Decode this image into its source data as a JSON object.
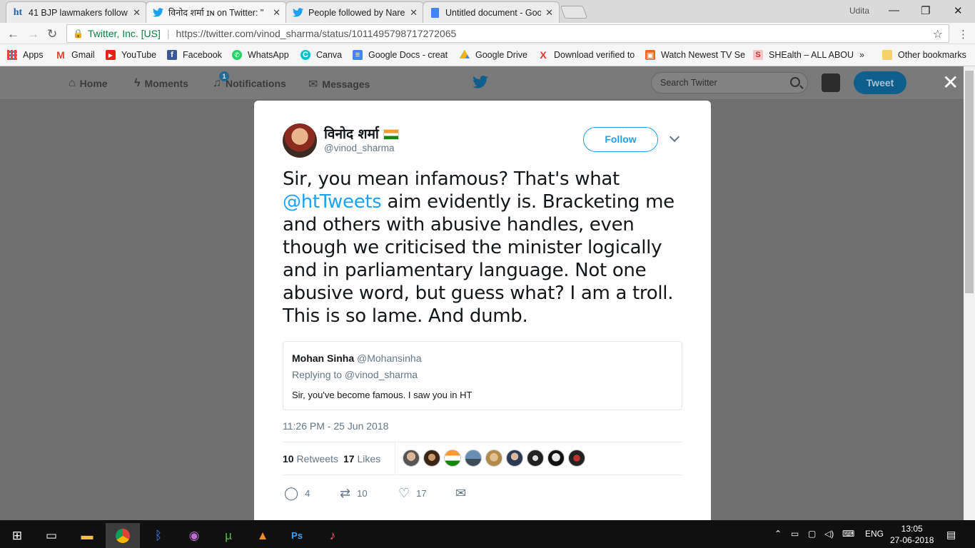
{
  "browser": {
    "tabs": [
      {
        "title": "41 BJP lawmakers follow",
        "icon": "ht-logo-icon"
      },
      {
        "title": "विनोद शर्मा ɪɴ on Twitter: \"",
        "icon": "twitter-bird-icon"
      },
      {
        "title": "People followed by Naren",
        "icon": "twitter-bird-icon"
      },
      {
        "title": "Untitled document - Goo",
        "icon": "google-docs-icon"
      }
    ],
    "user": "Udita",
    "secure_label": "Twitter, Inc. [US]",
    "url": "https://twitter.com/vinod_sharma/status/1011495798717272065",
    "bookmarks": [
      {
        "label": "Apps",
        "icon": "apps-grid-icon"
      },
      {
        "label": "Gmail",
        "icon": "gmail-icon"
      },
      {
        "label": "YouTube",
        "icon": "youtube-icon"
      },
      {
        "label": "Facebook",
        "icon": "facebook-icon"
      },
      {
        "label": "WhatsApp",
        "icon": "whatsapp-icon"
      },
      {
        "label": "Canva",
        "icon": "canva-icon"
      },
      {
        "label": "Google Docs - creat",
        "icon": "google-docs-icon"
      },
      {
        "label": "Google Drive",
        "icon": "google-drive-icon"
      },
      {
        "label": "Download verified to",
        "icon": "x-icon"
      },
      {
        "label": "Watch Newest TV Se",
        "icon": "movie-icon"
      },
      {
        "label": "SHEalth – ALL ABOU",
        "icon": "shealth-icon"
      }
    ],
    "bookmarks_more": "»",
    "other_bookmarks": "Other bookmarks"
  },
  "twitter_nav": {
    "home": "Home",
    "moments": "Moments",
    "notifications": "Notifications",
    "notification_count": "1",
    "messages": "Messages",
    "search_placeholder": "Search Twitter",
    "tweet_button": "Tweet"
  },
  "tweet": {
    "author_name": "विनोद शर्मा",
    "author_handle": "@vinod_sharma",
    "follow_label": "Follow",
    "text_before": "Sir, you mean infamous? That's what ",
    "mention": "@htTweets",
    "text_after": " aim evidently is. Bracketing me and others with abusive handles, even though we criticised the minister logically and in parliamentary language. Not one abusive word, but guess what? I am a troll. This is so lame. And dumb.",
    "quoted": {
      "name": "Mohan Sinha",
      "handle": "@Mohansinha",
      "replying_to": "Replying to @vinod_sharma",
      "text": "Sir, you've become famous. I saw you in HT"
    },
    "timestamp": "11:26 PM - 25 Jun 2018",
    "retweet_count": "10",
    "retweets_label": "Retweets",
    "like_count": "17",
    "likes_label": "Likes",
    "actions": {
      "reply": "4",
      "retweet": "10",
      "like": "17"
    }
  },
  "taskbar": {
    "language": "ENG",
    "time": "13:05",
    "date": "27-06-2018"
  }
}
